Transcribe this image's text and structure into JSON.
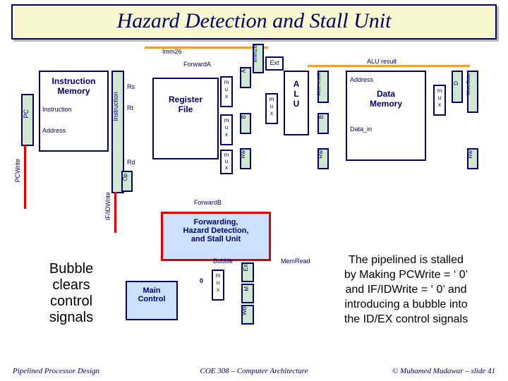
{
  "title": "Hazard Detection and Stall Unit",
  "labels": {
    "imm26_top": "Imm26",
    "imm26_v": "Imm26",
    "forwardA": "ForwardA",
    "forwardB": "ForwardB",
    "ext": "Ext",
    "pc": "PC",
    "pcwrite": "PCWrite",
    "ifidwrite": "IF/IDWrite",
    "instruction": "Instruction",
    "address": "Address",
    "instr_mem": "Instruction\nMemory",
    "rs": "Rs",
    "rt": "Rt",
    "rd": "Rd",
    "regfile": "Register\nFile",
    "op": "Op",
    "alu": "A\nL\nU",
    "alu_result": "ALU result",
    "alu_result_v": "ALU result",
    "a": "A",
    "b": "B",
    "b2": "B",
    "rw": "Rw",
    "data_mem": "Data\nMemory",
    "data_addr": "Address",
    "data_in": "Data_in",
    "writedata": "WriteData",
    "d": "D",
    "mux_m": "m",
    "mux_u": "u",
    "mux_x": "x",
    "fwd_unit": "Forwarding,\nHazard Detection,\nand Stall Unit",
    "main_control": "Main\nControl",
    "bubble": "Bubble",
    "zero": "0",
    "memread": "MemRead",
    "ex": "EX",
    "m": "M",
    "wb": "WB"
  },
  "callouts": {
    "bubble_clears": "Bubble\nclears\ncontrol\nsignals",
    "stall_note": "The pipelined is stalled\nby Making PCWrite = ‘ 0’\nand IF/IDWrite = ‘ 0’ and\nintroducing a bubble into\nthe ID/EX control signals"
  },
  "footer": {
    "left": "Pipelined Processor Design",
    "center": "COE 308 – Computer Architecture",
    "right": "© Muhamed Mudawar – slide 41"
  }
}
